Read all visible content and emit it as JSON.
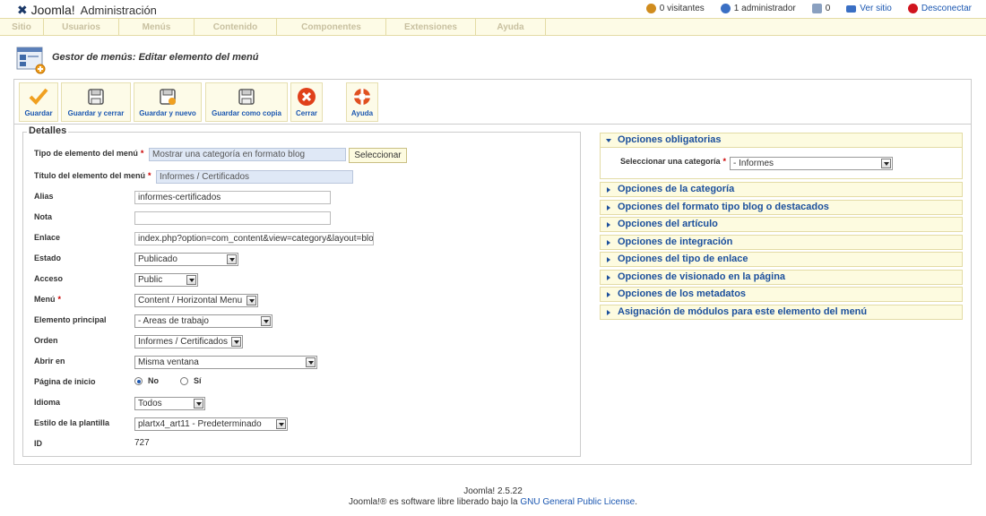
{
  "header": {
    "logo_text": "Joomla!",
    "admin_text": "Administración",
    "status": [
      {
        "label": "0 visitantes",
        "icon": "visitors-icon",
        "color": "#d08c1e"
      },
      {
        "label": "1 administrador",
        "icon": "admin-user-icon",
        "color": "#3a6fc4"
      },
      {
        "label": "0",
        "icon": "messages-icon",
        "color": "#8aa0c0"
      },
      {
        "label": "Ver sitio",
        "icon": "view-site-icon",
        "color": "#3a6fc4"
      },
      {
        "label": "Desconectar",
        "icon": "logout-icon",
        "color": "#d0141e"
      }
    ]
  },
  "menubar": {
    "items": [
      "Sitio",
      "Usuarios",
      "Menús",
      "Contenido",
      "Componentes",
      "Extensiones",
      "Ayuda"
    ]
  },
  "page": {
    "title": "Gestor de menús: Editar elemento del menú"
  },
  "toolbar": {
    "buttons": [
      {
        "label": "Guardar",
        "icon": "save-check-icon"
      },
      {
        "label": "Guardar y cerrar",
        "icon": "save-close-icon"
      },
      {
        "label": "Guardar y nuevo",
        "icon": "save-new-icon"
      },
      {
        "label": "Guardar como copia",
        "icon": "save-copy-icon"
      },
      {
        "label": "Cerrar",
        "icon": "close-icon"
      },
      {
        "label": "Ayuda",
        "icon": "help-lifebuoy-icon"
      }
    ]
  },
  "details": {
    "legend": "Detalles",
    "fields": {
      "tipo": {
        "label": "Tipo de elemento del menú",
        "value": "Mostrar una categoría en formato blog",
        "button": "Seleccionar"
      },
      "titulo": {
        "label": "Título del elemento del menú",
        "value": "Informes / Certificados"
      },
      "alias": {
        "label": "Alias",
        "value": "informes-certificados"
      },
      "nota": {
        "label": "Nota",
        "value": ""
      },
      "enlace": {
        "label": "Enlace",
        "value": "index.php?option=com_content&view=category&layout=blog"
      },
      "estado": {
        "label": "Estado",
        "value": "Publicado"
      },
      "acceso": {
        "label": "Acceso",
        "value": "Public"
      },
      "menu": {
        "label": "Menú",
        "value": "Content / Horizontal Menu"
      },
      "principal": {
        "label": "Elemento principal",
        "value": "- Areas de trabajo"
      },
      "orden": {
        "label": "Orden",
        "value": "Informes / Certificados"
      },
      "abrir": {
        "label": "Abrir en",
        "value": "Misma ventana"
      },
      "inicio": {
        "label": "Página de inicio",
        "options": [
          "No",
          "Sí"
        ],
        "selected": "No"
      },
      "idioma": {
        "label": "Idioma",
        "value": "Todos"
      },
      "estilo": {
        "label": "Estilo de la plantilla",
        "value": "plartx4_art11 - Predeterminado"
      },
      "id": {
        "label": "ID",
        "value": "727"
      }
    },
    "required_mark": "*"
  },
  "options": {
    "required": {
      "title": "Opciones obligatorias",
      "category_label": "Seleccionar una categoría",
      "category_value": "- Informes"
    },
    "panels": [
      "Opciones de la categoría",
      "Opciones del formato tipo blog o destacados",
      "Opciones del artículo",
      "Opciones de integración",
      "Opciones del tipo de enlace",
      "Opciones de visionado en la página",
      "Opciones de los metadatos",
      "Asignación de módulos para este elemento del menú"
    ]
  },
  "footer": {
    "version": "Joomla! 2.5.22",
    "license_prefix": "Joomla!® es software libre liberado bajo la",
    "license_link": "GNU General Public License",
    "license_suffix": "."
  }
}
